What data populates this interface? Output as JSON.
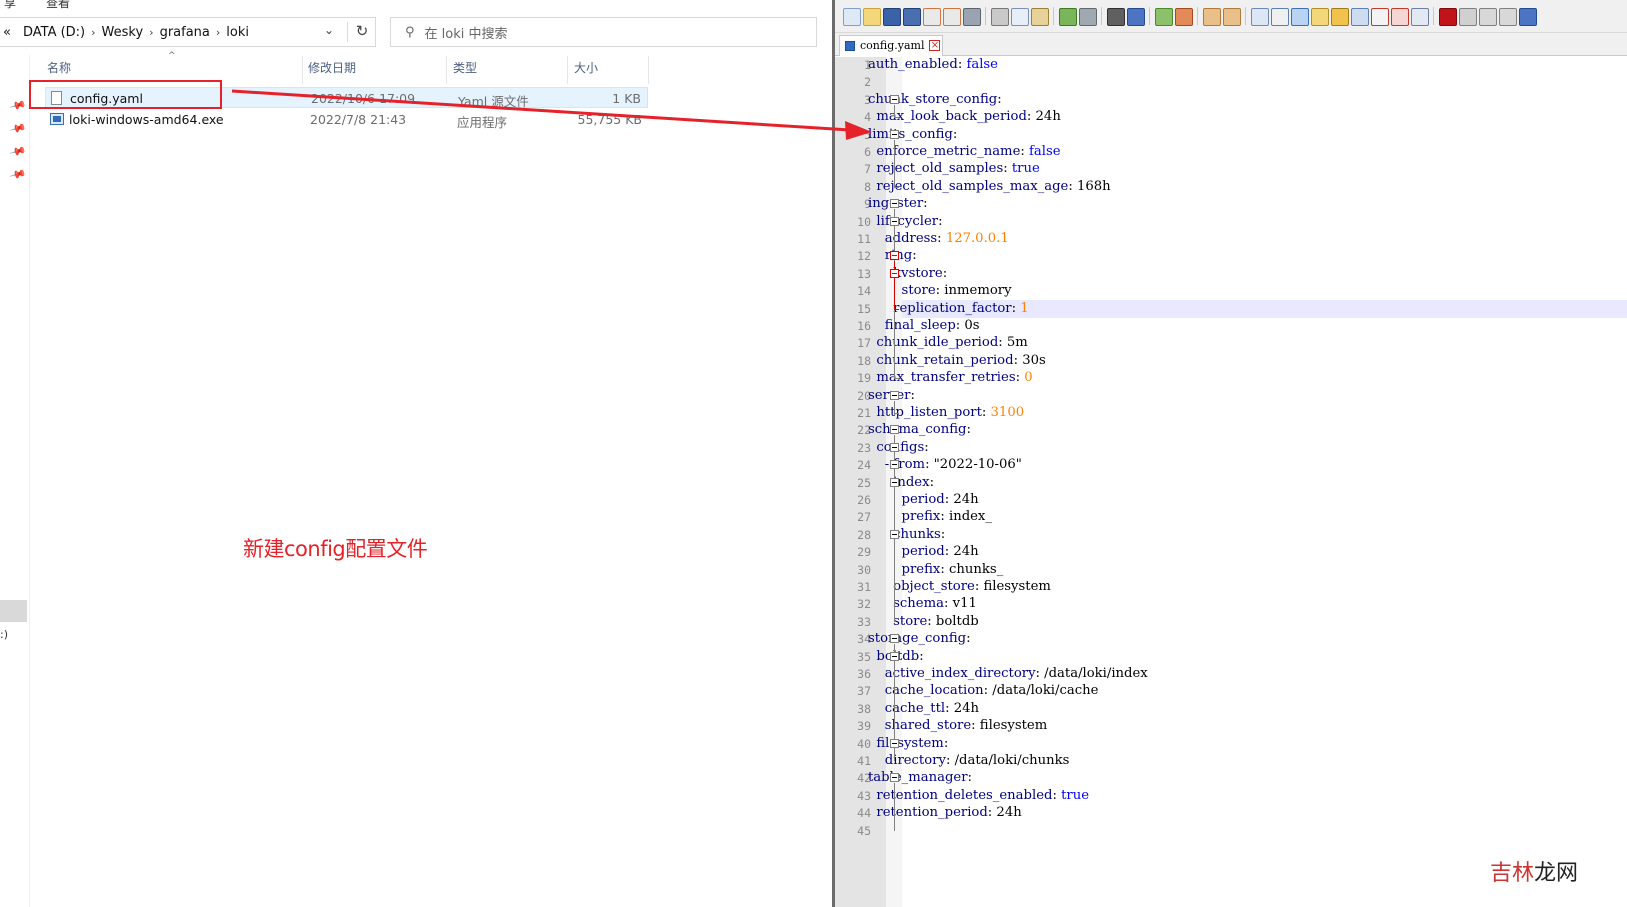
{
  "explorer": {
    "top_strip": {
      "left_text": "享",
      "mid_text": "查看"
    },
    "address": {
      "prefix": "«",
      "segments": [
        "DATA (D:)",
        "Wesky",
        "grafana",
        "loki"
      ],
      "dropdown_glyph": "⌄",
      "refresh_glyph": "↻"
    },
    "search": {
      "placeholder": "在 loki 中搜索"
    },
    "columns": {
      "name": "名称",
      "modified": "修改日期",
      "type": "类型",
      "size": "大小"
    },
    "files": [
      {
        "name": "config.yaml",
        "modified": "2022/10/6 17:09",
        "type": "Yaml 源文件",
        "size": "1 KB",
        "icon": "file-icon"
      },
      {
        "name": "loki-windows-amd64.exe",
        "modified": "2022/7/8 21:43",
        "type": "应用程序",
        "size": "55,755 KB",
        "icon": "exe-icon"
      }
    ],
    "nav_fragment": ":)",
    "annotation": "新建config配置文件",
    "annotation_color": "#e5222a"
  },
  "editor": {
    "tab_title": "config.yaml",
    "lines": [
      [
        [
          "k",
          "auth_enabled"
        ],
        [
          "t",
          ": "
        ],
        [
          "b",
          "false"
        ]
      ],
      [],
      [
        [
          "k",
          "chunk_store_config"
        ],
        [
          "t",
          ":"
        ]
      ],
      [
        [
          "t",
          "  "
        ],
        [
          "k",
          "max_look_back_period"
        ],
        [
          "t",
          ": 24h"
        ]
      ],
      [
        [
          "k",
          "limits_config"
        ],
        [
          "t",
          ":"
        ]
      ],
      [
        [
          "t",
          "  "
        ],
        [
          "k",
          "enforce_metric_name"
        ],
        [
          "t",
          ": "
        ],
        [
          "b",
          "false"
        ]
      ],
      [
        [
          "t",
          "  "
        ],
        [
          "k",
          "reject_old_samples"
        ],
        [
          "t",
          ": "
        ],
        [
          "b",
          "true"
        ]
      ],
      [
        [
          "t",
          "  "
        ],
        [
          "k",
          "reject_old_samples_max_age"
        ],
        [
          "t",
          ": 168h"
        ]
      ],
      [
        [
          "k",
          "ingester"
        ],
        [
          "t",
          ":"
        ]
      ],
      [
        [
          "t",
          "  "
        ],
        [
          "k",
          "lifecycler"
        ],
        [
          "t",
          ":"
        ]
      ],
      [
        [
          "t",
          "    "
        ],
        [
          "k",
          "address"
        ],
        [
          "t",
          ": "
        ],
        [
          "n",
          "127.0.0.1"
        ]
      ],
      [
        [
          "t",
          "    "
        ],
        [
          "k",
          "ring"
        ],
        [
          "t",
          ":"
        ]
      ],
      [
        [
          "t",
          "      "
        ],
        [
          "k",
          "kvstore"
        ],
        [
          "t",
          ":"
        ]
      ],
      [
        [
          "t",
          "        "
        ],
        [
          "k",
          "store"
        ],
        [
          "t",
          ": inmemory"
        ]
      ],
      [
        [
          "t",
          "      "
        ],
        [
          "k",
          "replication_factor"
        ],
        [
          "t",
          ": "
        ],
        [
          "n",
          "1"
        ]
      ],
      [
        [
          "t",
          "    "
        ],
        [
          "k",
          "final_sleep"
        ],
        [
          "t",
          ": 0s"
        ]
      ],
      [
        [
          "t",
          "  "
        ],
        [
          "k",
          "chunk_idle_period"
        ],
        [
          "t",
          ": 5m"
        ]
      ],
      [
        [
          "t",
          "  "
        ],
        [
          "k",
          "chunk_retain_period"
        ],
        [
          "t",
          ": 30s"
        ]
      ],
      [
        [
          "t",
          "  "
        ],
        [
          "k",
          "max_transfer_retries"
        ],
        [
          "t",
          ": "
        ],
        [
          "n",
          "0"
        ]
      ],
      [
        [
          "k",
          "server"
        ],
        [
          "t",
          ":"
        ]
      ],
      [
        [
          "t",
          "  "
        ],
        [
          "k",
          "http_listen_port"
        ],
        [
          "t",
          ": "
        ],
        [
          "n",
          "3100"
        ]
      ],
      [
        [
          "k",
          "schema_config"
        ],
        [
          "t",
          ":"
        ]
      ],
      [
        [
          "t",
          "  "
        ],
        [
          "k",
          "configs"
        ],
        [
          "t",
          ":"
        ]
      ],
      [
        [
          "t",
          "    "
        ],
        [
          "k",
          "- from"
        ],
        [
          "t",
          ": \"2022-10-06\""
        ]
      ],
      [
        [
          "t",
          "      "
        ],
        [
          "k",
          "index"
        ],
        [
          "t",
          ":"
        ]
      ],
      [
        [
          "t",
          "        "
        ],
        [
          "k",
          "period"
        ],
        [
          "t",
          ": 24h"
        ]
      ],
      [
        [
          "t",
          "        "
        ],
        [
          "k",
          "prefix"
        ],
        [
          "t",
          ": index_"
        ]
      ],
      [
        [
          "t",
          "      "
        ],
        [
          "k",
          "chunks"
        ],
        [
          "t",
          ":"
        ]
      ],
      [
        [
          "t",
          "        "
        ],
        [
          "k",
          "period"
        ],
        [
          "t",
          ": 24h"
        ]
      ],
      [
        [
          "t",
          "        "
        ],
        [
          "k",
          "prefix"
        ],
        [
          "t",
          ": chunks_"
        ]
      ],
      [
        [
          "t",
          "      "
        ],
        [
          "k",
          "object_store"
        ],
        [
          "t",
          ": filesystem"
        ]
      ],
      [
        [
          "t",
          "      "
        ],
        [
          "k",
          "schema"
        ],
        [
          "t",
          ": v11"
        ]
      ],
      [
        [
          "t",
          "      "
        ],
        [
          "k",
          "store"
        ],
        [
          "t",
          ": boltdb"
        ]
      ],
      [
        [
          "k",
          "storage_config"
        ],
        [
          "t",
          ":"
        ]
      ],
      [
        [
          "t",
          "  "
        ],
        [
          "k",
          "boltdb"
        ],
        [
          "t",
          ":"
        ]
      ],
      [
        [
          "t",
          "    "
        ],
        [
          "k",
          "active_index_directory"
        ],
        [
          "t",
          ": /data/loki/index"
        ]
      ],
      [
        [
          "t",
          "    "
        ],
        [
          "k",
          "cache_location"
        ],
        [
          "t",
          ": /data/loki/cache"
        ]
      ],
      [
        [
          "t",
          "    "
        ],
        [
          "k",
          "cache_ttl"
        ],
        [
          "t",
          ": 24h"
        ]
      ],
      [
        [
          "t",
          "    "
        ],
        [
          "k",
          "shared_store"
        ],
        [
          "t",
          ": filesystem"
        ]
      ],
      [
        [
          "t",
          "  "
        ],
        [
          "k",
          "filesystem"
        ],
        [
          "t",
          ":"
        ]
      ],
      [
        [
          "t",
          "    "
        ],
        [
          "k",
          "directory"
        ],
        [
          "t",
          ": /data/loki/chunks"
        ]
      ],
      [
        [
          "k",
          "table_manager"
        ],
        [
          "t",
          ":"
        ]
      ],
      [
        [
          "t",
          "  "
        ],
        [
          "k",
          "retention_deletes_enabled"
        ],
        [
          "t",
          ": "
        ],
        [
          "b",
          "true"
        ]
      ],
      [
        [
          "t",
          "  "
        ],
        [
          "k",
          "retention_period"
        ],
        [
          "t",
          ": 24h"
        ]
      ],
      []
    ],
    "current_line": 15,
    "colors": {
      "key": "#000080",
      "bool": "#0000ff",
      "number": "#ff8000",
      "current_line": "#e8e8ff"
    }
  },
  "watermark": {
    "part1": "吉林",
    "part2": "龙网"
  }
}
